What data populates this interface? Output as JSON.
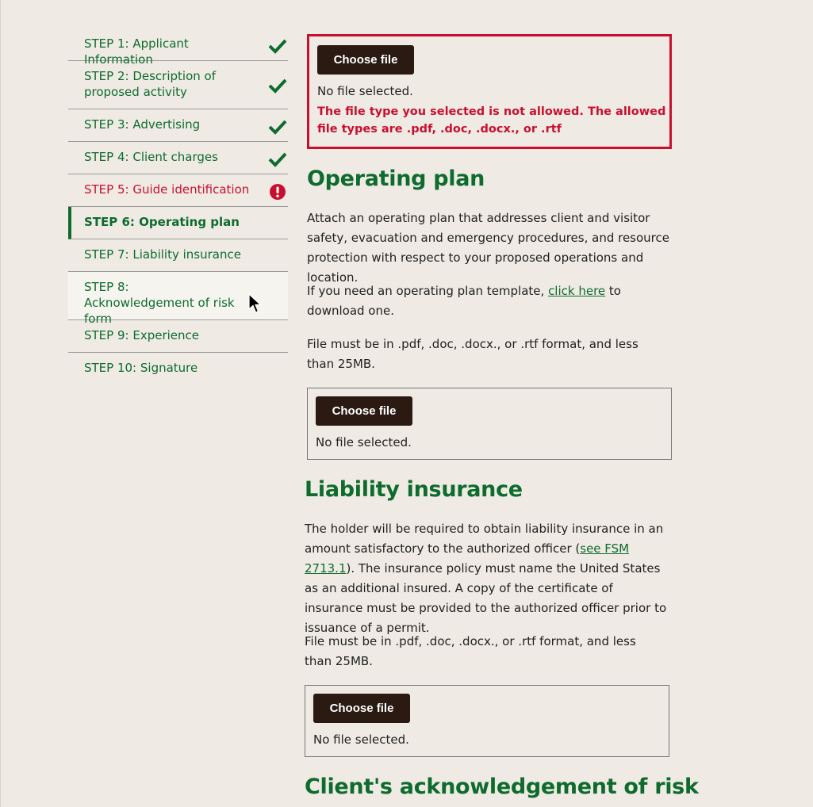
{
  "sidebar": {
    "steps": [
      {
        "label": "STEP 1: Applicant  Information",
        "status": "complete"
      },
      {
        "label": "STEP 2: Description of proposed activity",
        "status": "complete"
      },
      {
        "label": "STEP 3: Advertising",
        "status": "complete"
      },
      {
        "label": "STEP 4: Client charges",
        "status": "complete"
      },
      {
        "label": "STEP 5: Guide identification",
        "status": "error"
      },
      {
        "label": "STEP 6: Operating plan",
        "status": "current"
      },
      {
        "label": "STEP 7: Liability insurance",
        "status": "none"
      },
      {
        "label": "STEP 8: Acknowledgement of risk form",
        "status": "hover"
      },
      {
        "label": "STEP 9: Experience",
        "status": "none"
      },
      {
        "label": "STEP 10: Signature",
        "status": "none"
      }
    ]
  },
  "upload_top": {
    "button_label": "Choose file",
    "status_text": "No file selected.",
    "error_text": "The file type you selected is not allowed. The allowed file types are .pdf, .doc, .docx., or .rtf"
  },
  "operating_plan": {
    "heading": "Operating plan",
    "paragraph1": "Attach an operating plan that addresses client and visitor safety, evacuation and emergency procedures, and resource protection with respect to your proposed operations and location.",
    "paragraph2_before": "If you need an operating plan template, ",
    "paragraph2_link": "click here",
    "paragraph2_after": " to download one.",
    "paragraph3": "File must be in .pdf, .doc, .docx., or .rtf format, and less than 25MB.",
    "button_label": "Choose file",
    "status_text": "No file selected."
  },
  "liability_insurance": {
    "heading": "Liability insurance",
    "paragraph1_before": "The holder will be required to obtain liability insurance in an amount satisfactory to the authorized officer (",
    "paragraph1_link": "see FSM 2713.1",
    "paragraph1_after": "). The insurance policy must name the United States as an additional insured. A copy of the certificate of insurance must be provided to the authorized officer prior to issuance of a permit.",
    "paragraph2": "File must be in .pdf, .doc, .docx., or .rtf format, and less than 25MB.",
    "button_label": "Choose file",
    "status_text": "No file selected."
  },
  "acknowledgement": {
    "heading": "Client's acknowledgement of risk"
  },
  "colors": {
    "brand_green": "#0e6b2e",
    "error_red": "#c8102e",
    "button_dark": "#2a1a12",
    "background": "#efebe4"
  },
  "icons": {
    "complete": "checkmark-icon",
    "error": "exclamation-icon"
  }
}
